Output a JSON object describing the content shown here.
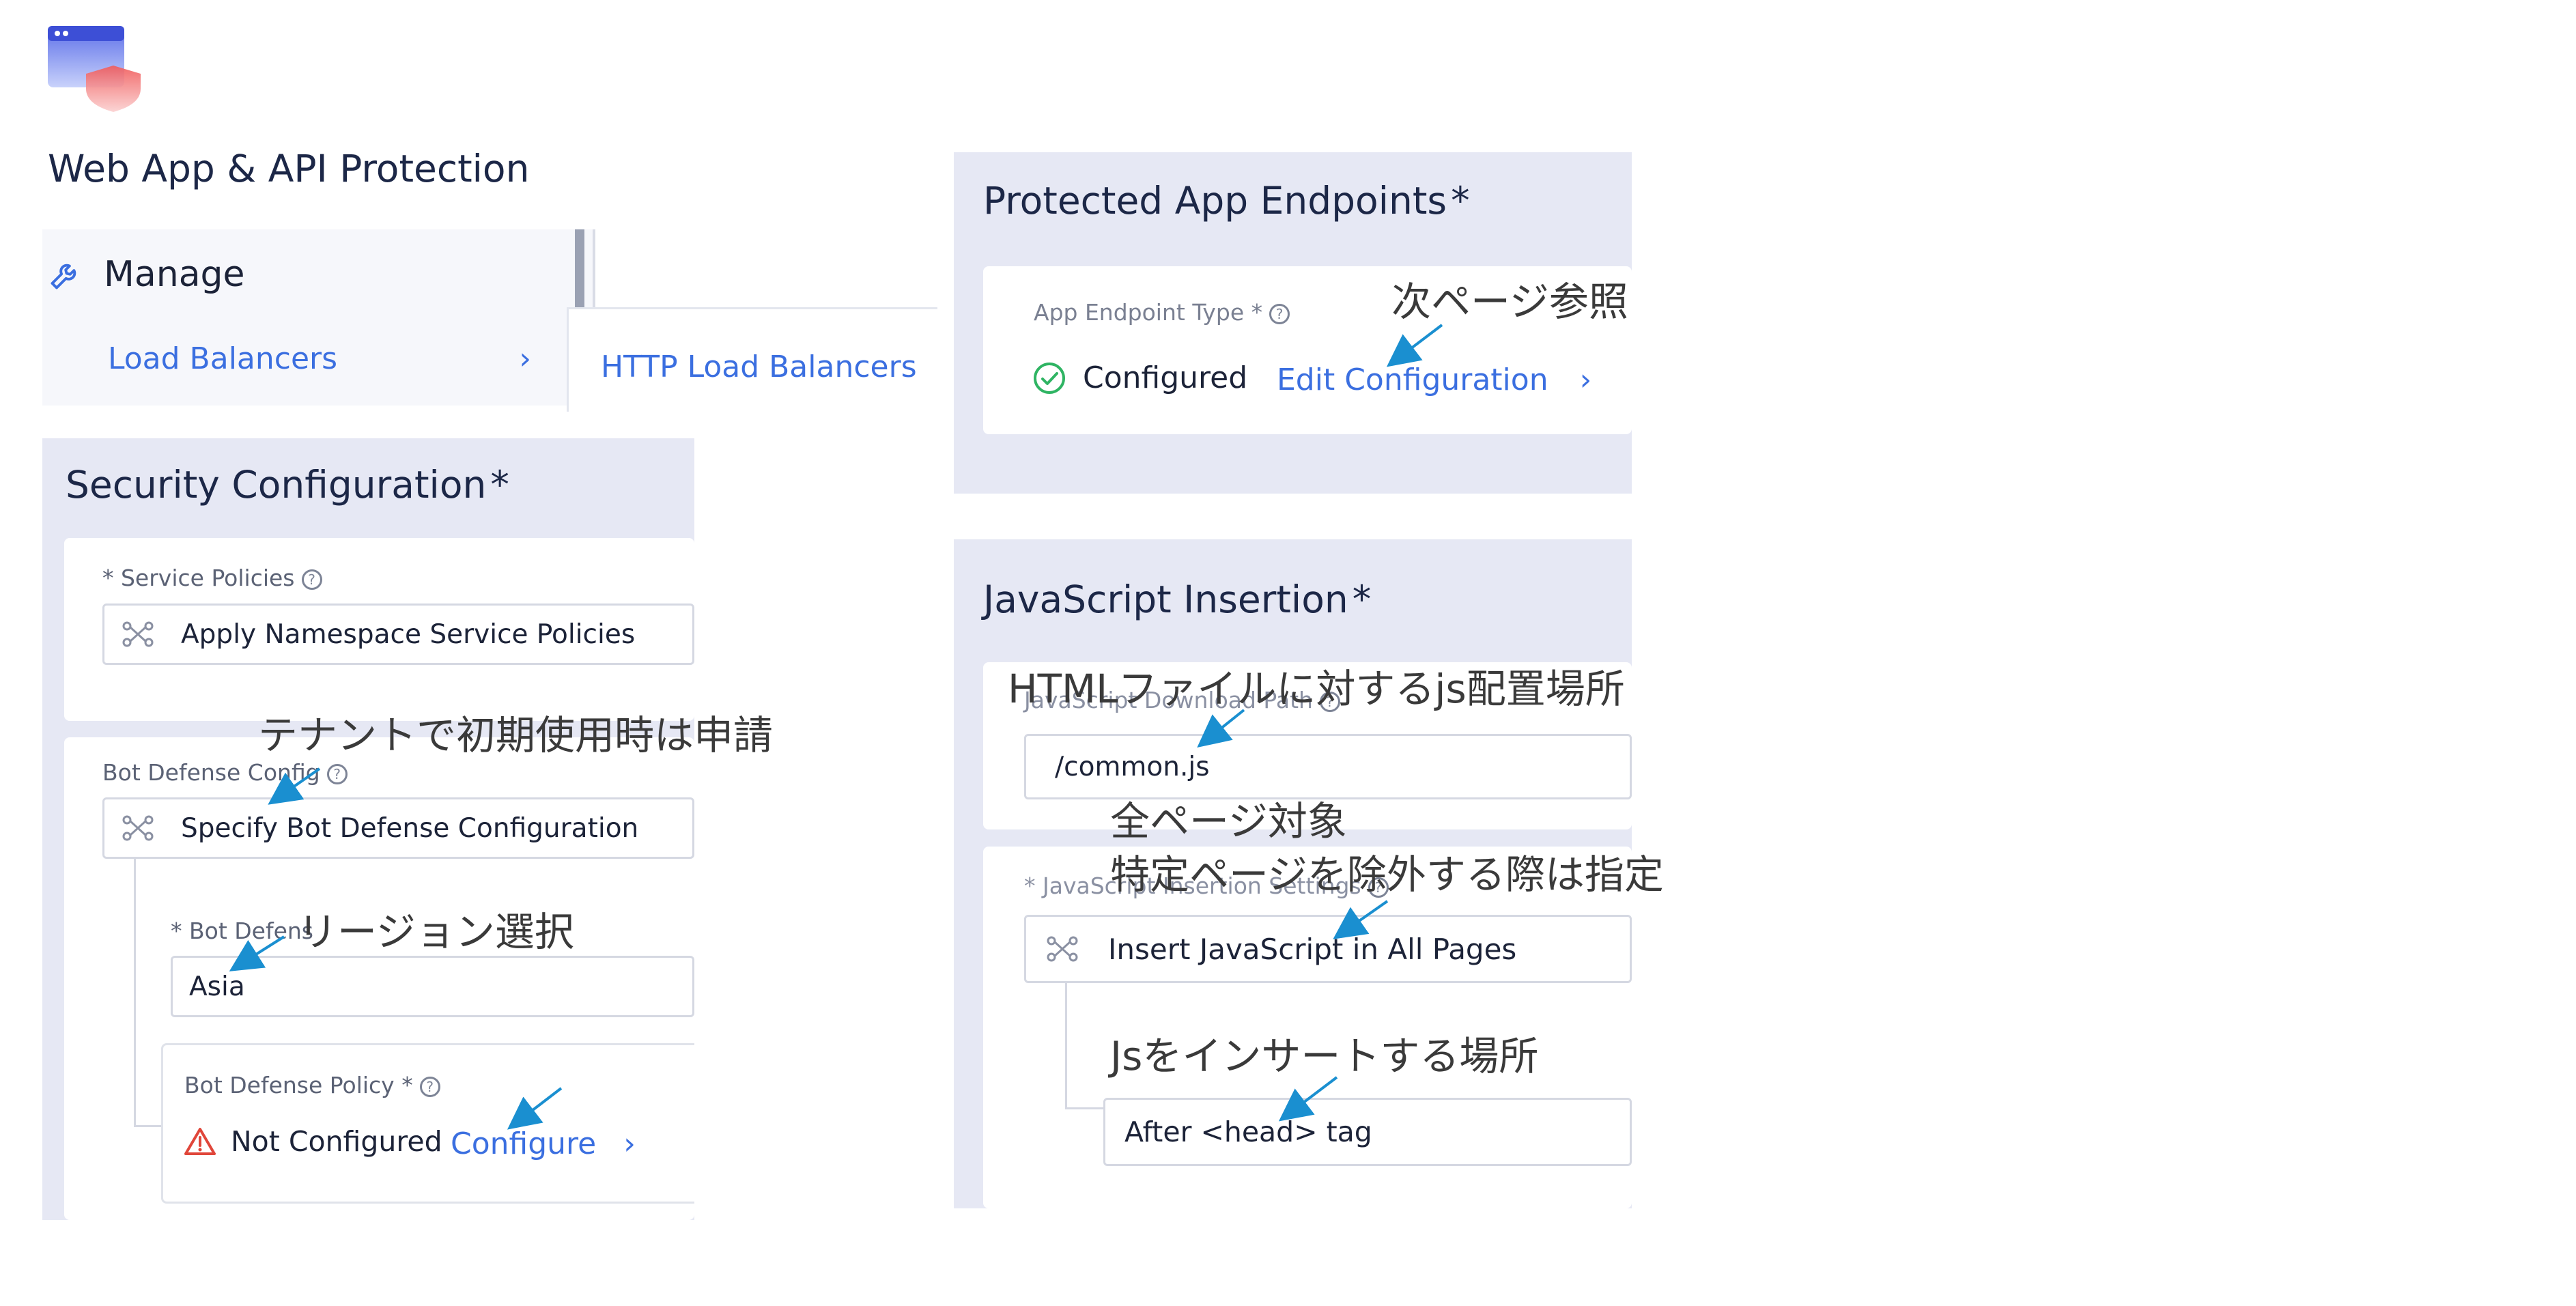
{
  "app": {
    "title": "Web App & API Protection",
    "logo_icon": "web-app-shield-logo"
  },
  "nav": {
    "manage_label": "Manage",
    "manage_icon": "wrench-icon",
    "load_balancers_label": "Load Balancers",
    "http_lb_label": "HTTP Load Balancers"
  },
  "security": {
    "title": "Security Configuration",
    "required_mark": "*",
    "service_policies_label": "* Service Policies",
    "service_policies_value": "Apply Namespace Service Policies",
    "bot_defense_config_label": "Bot Defense Config",
    "bot_defense_config_value": "Specify Bot Defense Configuration",
    "bot_defense_region_label": "* Bot Defens",
    "bot_defense_region_value": "Asia",
    "bot_defense_policy_label": "Bot Defense Policy *",
    "bot_defense_policy_status": "Not Configured",
    "bot_defense_policy_action": "Configure"
  },
  "endpoints": {
    "title": "Protected App Endpoints",
    "required_mark": "*",
    "type_label": "App Endpoint Type *",
    "status": "Configured",
    "action": "Edit Configuration"
  },
  "js_insertion": {
    "title": "JavaScript Insertion",
    "required_mark": "*",
    "download_path_label": "JavaScript Download Path",
    "download_path_value": "/common.js",
    "settings_label": "* JavaScript Insertion Settings",
    "settings_value": "Insert JavaScript in All Pages",
    "location_value": "After <head> tag"
  },
  "annotations": {
    "next_page": "次ページ参照",
    "tenant_apply": "テナントで初期使用時は申請",
    "region_select": "リージョン選択",
    "js_location": "HTMLファイルに対するjs配置場所",
    "all_pages_line1": "全ページ対象",
    "all_pages_line2": "特定ページを除外する際は指定",
    "insert_location": "Jsをインサートする場所"
  },
  "colors": {
    "panel_bg": "#e6e8f4",
    "link": "#3b6fe0",
    "arrow": "#1a8fd0",
    "success": "#2fb463",
    "warning": "#e0463a"
  }
}
